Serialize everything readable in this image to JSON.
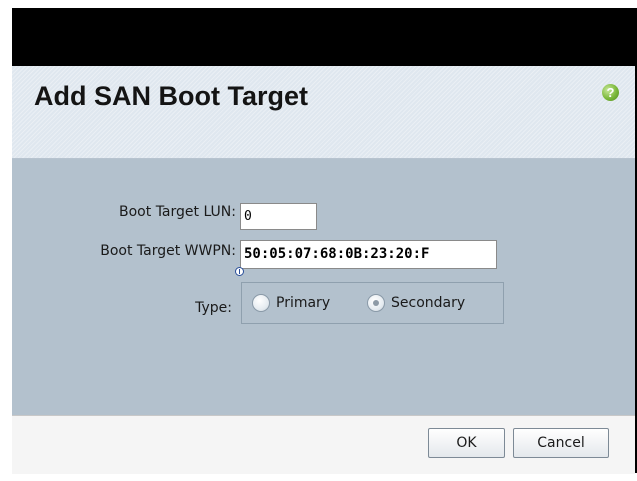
{
  "dialog": {
    "title": "Add SAN Boot Target",
    "help_icon": "help-icon",
    "help_symbol": "?"
  },
  "form": {
    "lun_label": "Boot Target LUN:",
    "lun_value": "0",
    "wwpn_label": "Boot Target WWPN:",
    "wwpn_value": "50:05:07:68:0B:23:20:F",
    "type_label": "Type:",
    "type_options": [
      {
        "label": "Primary",
        "selected": false
      },
      {
        "label": "Secondary",
        "selected": true
      }
    ]
  },
  "footer": {
    "ok_label": "OK",
    "cancel_label": "Cancel"
  },
  "colors": {
    "header_bg": "#dfe7ef",
    "body_bg": "#b3c1cd",
    "footer_bg": "#f5f5f5",
    "help_icon_green": "#7bb83a"
  }
}
